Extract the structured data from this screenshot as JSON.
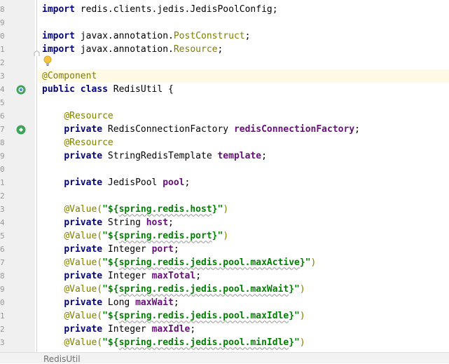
{
  "gutter": {
    "line_number_digits": [
      "8",
      "9",
      "0",
      "1",
      "2",
      "3",
      "4",
      "5",
      "6",
      "7",
      "8",
      "9",
      "0",
      "1",
      "2",
      "3",
      "4",
      "5",
      "6",
      "7",
      "8",
      "9",
      "0",
      "1",
      "2",
      "3"
    ]
  },
  "code": {
    "l0_a": "import",
    "l0_b": " redis.clients.jedis.JedisPoolConfig;",
    "l2_a": "import",
    "l2_b": " javax.annotation.",
    "l2_c": "PostConstruct",
    "l2_d": ";",
    "l3_a": "import",
    "l3_b": " javax.annotation.",
    "l3_c": "Resource",
    "l3_d": ";",
    "l5_a": "@Component",
    "l6_a": "public class",
    "l6_b": " RedisUtil {",
    "l8_a": "@Resource",
    "l9_a": "private",
    "l9_b": " RedisConnectionFactory ",
    "l9_c": "redisConnectionFactory",
    "l9_d": ";",
    "l10_a": "@Resource",
    "l11_a": "private",
    "l11_b": " StringRedisTemplate ",
    "l11_c": "template",
    "l11_d": ";",
    "l13_a": "private",
    "l13_b": " JedisPool ",
    "l13_c": "pool",
    "l13_d": ";",
    "l15_a": "@Value(",
    "l15_b": "\"${",
    "l15_c": "spring.redis.host",
    "l15_d": "}\"",
    "l15_e": ")",
    "l16_a": "private",
    "l16_b": " String ",
    "l16_c": "host",
    "l16_d": ";",
    "l17_a": "@Value(",
    "l17_b": "\"${",
    "l17_c": "spring.redis.port",
    "l17_d": "}\"",
    "l17_e": ")",
    "l18_a": "private",
    "l18_b": " Integer ",
    "l18_c": "port",
    "l18_d": ";",
    "l19_a": "@Value(",
    "l19_b": "\"${",
    "l19_c": "spring.redis.jedis.pool.maxActive",
    "l19_d": "}\"",
    "l19_e": ")",
    "l20_a": "private",
    "l20_b": " Integer ",
    "l20_c": "maxTotal",
    "l20_d": ";",
    "l21_a": "@Value(",
    "l21_b": "\"${",
    "l21_c": "spring.redis.jedis.pool.maxWait",
    "l21_d": "}\"",
    "l21_e": ")",
    "l22_a": "private",
    "l22_b": " Long ",
    "l22_c": "maxWait",
    "l22_d": ";",
    "l23_a": "@Value(",
    "l23_b": "\"${",
    "l23_c": "spring.redis.jedis.pool.maxIdle",
    "l23_d": "}\"",
    "l23_e": ")",
    "l24_a": "private",
    "l24_b": " Integer ",
    "l24_c": "maxIdle",
    "l24_d": ";",
    "l25_a": "@Value(",
    "l25_b": "\"${",
    "l25_c": "spring.redis.jedis.pool.minIdle",
    "l25_d": "}\"",
    "l25_e": ")"
  },
  "statusbar": {
    "breadcrumb": "RedisUtil"
  },
  "icons": {
    "gutter_bean": "spring-bean-icon",
    "gutter_autowired": "spring-autowired-icon",
    "intention": "lightbulb-icon",
    "fold": "fold-marker-icon"
  },
  "colors": {
    "keyword": "#000080",
    "annotation": "#808000",
    "field": "#660e7a",
    "string": "#008000",
    "current_line": "#fffae3",
    "gutter": "#f0f0f0"
  }
}
